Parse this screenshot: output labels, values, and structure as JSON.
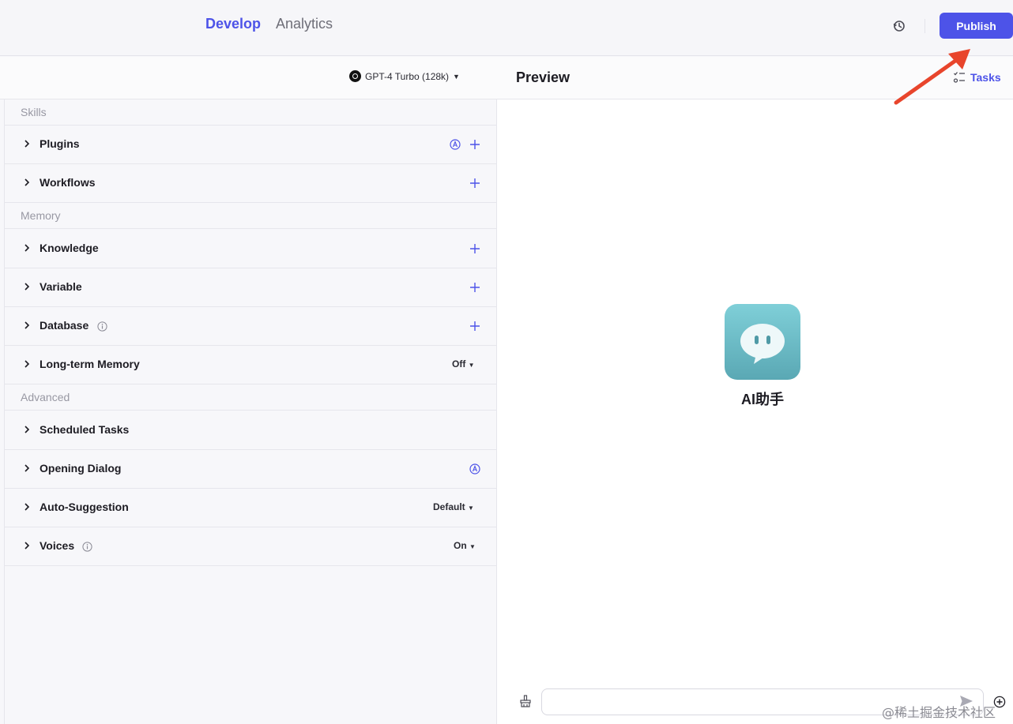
{
  "topbar": {
    "tabs": [
      {
        "label": "Develop",
        "active": true
      },
      {
        "label": "Analytics",
        "active": false
      }
    ],
    "history_icon": "history-clock-icon",
    "publish_label": "Publish"
  },
  "config": {
    "model_label": "GPT-4 Turbo (128k)"
  },
  "preview": {
    "title": "Preview",
    "tasks_label": "Tasks",
    "bot_name": "AI助手",
    "input_placeholder": "",
    "watermark": "@稀土掘金技术社区"
  },
  "sections": {
    "skills": {
      "label": "Skills",
      "items": [
        {
          "label": "Plugins"
        },
        {
          "label": "Workflows"
        }
      ]
    },
    "memory": {
      "label": "Memory",
      "items": [
        {
          "label": "Knowledge"
        },
        {
          "label": "Variable"
        },
        {
          "label": "Database"
        },
        {
          "label": "Long-term Memory",
          "value": "Off"
        }
      ]
    },
    "advanced": {
      "label": "Advanced",
      "items": [
        {
          "label": "Scheduled Tasks"
        },
        {
          "label": "Opening Dialog"
        },
        {
          "label": "Auto-Suggestion",
          "value": "Default"
        },
        {
          "label": "Voices",
          "value": "On"
        }
      ]
    }
  },
  "colors": {
    "accent": "#4d53e8",
    "annotation_arrow": "#e8452c",
    "avatar_top": "#7fcfd8",
    "avatar_bottom": "#5aa8b4"
  }
}
